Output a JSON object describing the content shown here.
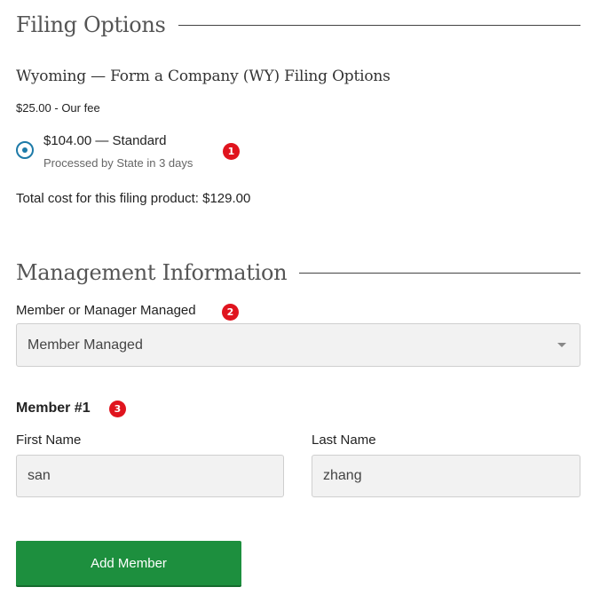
{
  "filing_options": {
    "heading": "Filing Options",
    "product_title": "Wyoming — Form a Company (WY) Filing Options",
    "our_fee": "$25.00 - Our fee",
    "option": {
      "label": "$104.00 — Standard",
      "sublabel": "Processed by State in 3 days",
      "selected": true
    },
    "total_cost": "Total cost for this filing product: $129.00"
  },
  "management": {
    "heading": "Management Information",
    "type_label": "Member or Manager Managed",
    "type_value": "Member Managed"
  },
  "member": {
    "heading": "Member #1",
    "first_name_label": "First Name",
    "first_name_value": "san",
    "last_name_label": "Last Name",
    "last_name_value": "zhang"
  },
  "add_member_label": "Add Member",
  "badges": [
    "1",
    "2",
    "3"
  ],
  "colors": {
    "accent": "#1d7aa8",
    "button": "#1d8f3e",
    "badge": "#e0141e"
  }
}
